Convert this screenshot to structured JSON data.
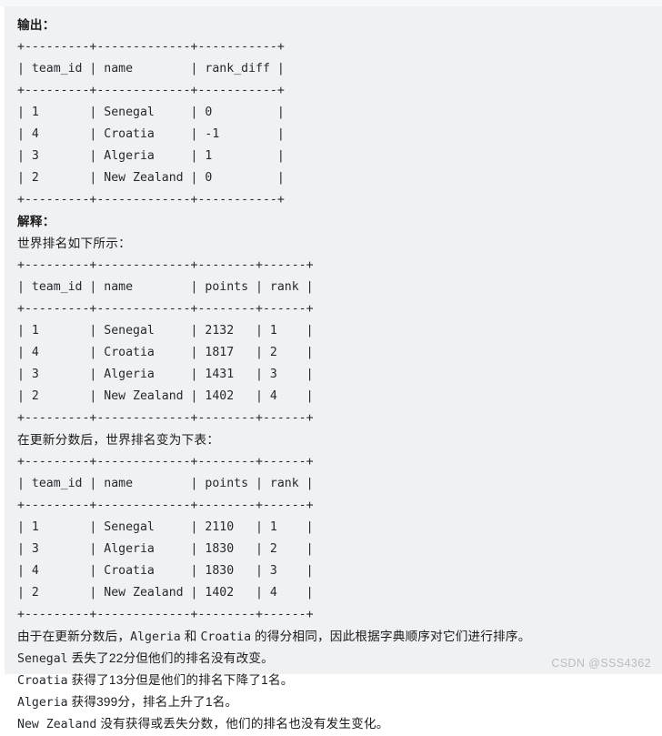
{
  "page": {
    "background_color": "#ffffff",
    "code_block_color": "#f0f1f3",
    "text_color": "#24292e"
  },
  "sections": {
    "output_heading": "输出：",
    "explanation_heading": "解释：",
    "world_rank_intro": "世界排名如下所示：",
    "after_update_intro": "在更新分数后，世界排名变为下表："
  },
  "output_table": {
    "rule": "+---------+-------------+-----------+",
    "header": "| team_id | name        | rank_diff |",
    "rows": [
      "| 1       | Senegal     | 0         |",
      "| 4       | Croatia     | -1        |",
      "| 3       | Algeria     | 1         |",
      "| 2       | New Zealand | 0         |"
    ],
    "columns": [
      "team_id",
      "name",
      "rank_diff"
    ],
    "data": [
      {
        "team_id": "1",
        "name": "Senegal",
        "rank_diff": "0"
      },
      {
        "team_id": "4",
        "name": "Croatia",
        "rank_diff": "-1"
      },
      {
        "team_id": "3",
        "name": "Algeria",
        "rank_diff": "1"
      },
      {
        "team_id": "2",
        "name": "New Zealand",
        "rank_diff": "0"
      }
    ]
  },
  "world_rank_table": {
    "rule": "+---------+-------------+--------+------+",
    "header": "| team_id | name        | points | rank |",
    "rows": [
      "| 1       | Senegal     | 2132   | 1    |",
      "| 4       | Croatia     | 1817   | 2    |",
      "| 3       | Algeria     | 1431   | 3    |",
      "| 2       | New Zealand | 1402   | 4    |"
    ],
    "columns": [
      "team_id",
      "name",
      "points",
      "rank"
    ],
    "data": [
      {
        "team_id": "1",
        "name": "Senegal",
        "points": "2132",
        "rank": "1"
      },
      {
        "team_id": "4",
        "name": "Croatia",
        "points": "1817",
        "rank": "2"
      },
      {
        "team_id": "3",
        "name": "Algeria",
        "points": "1431",
        "rank": "3"
      },
      {
        "team_id": "2",
        "name": "New Zealand",
        "points": "1402",
        "rank": "4"
      }
    ]
  },
  "updated_rank_table": {
    "rule": "+---------+-------------+--------+------+",
    "header": "| team_id | name        | points | rank |",
    "rows": [
      "| 1       | Senegal     | 2110   | 1    |",
      "| 3       | Algeria     | 1830   | 2    |",
      "| 4       | Croatia     | 1830   | 3    |",
      "| 2       | New Zealand | 1402   | 4    |"
    ],
    "columns": [
      "team_id",
      "name",
      "points",
      "rank"
    ],
    "data": [
      {
        "team_id": "1",
        "name": "Senegal",
        "points": "2110",
        "rank": "1"
      },
      {
        "team_id": "3",
        "name": "Algeria",
        "points": "1830",
        "rank": "2"
      },
      {
        "team_id": "4",
        "name": "Croatia",
        "points": "1830",
        "rank": "3"
      },
      {
        "team_id": "2",
        "name": "New Zealand",
        "points": "1402",
        "rank": "4"
      }
    ]
  },
  "notes": {
    "tie_note_a": "由于在更新分数后，",
    "tie_note_team1": "Algeria",
    "tie_note_b": " 和 ",
    "tie_note_team2": "Croatia",
    "tie_note_c": " 的得分相同，因此根据字典顺序对它们进行排序。",
    "senegal_team": "Senegal",
    "senegal_text": " 丢失了22分但他们的排名没有改变。",
    "croatia_team": "Croatia",
    "croatia_text": " 获得了13分但是他们的排名下降了1名。",
    "algeria_team": "Algeria",
    "algeria_text": " 获得399分，排名上升了1名。",
    "newzealand_team": "New Zealand",
    "newzealand_text": " 没有获得或丢失分数，他们的排名也没有发生变化。"
  },
  "watermark": {
    "text": "CSDN @SSS4362"
  }
}
